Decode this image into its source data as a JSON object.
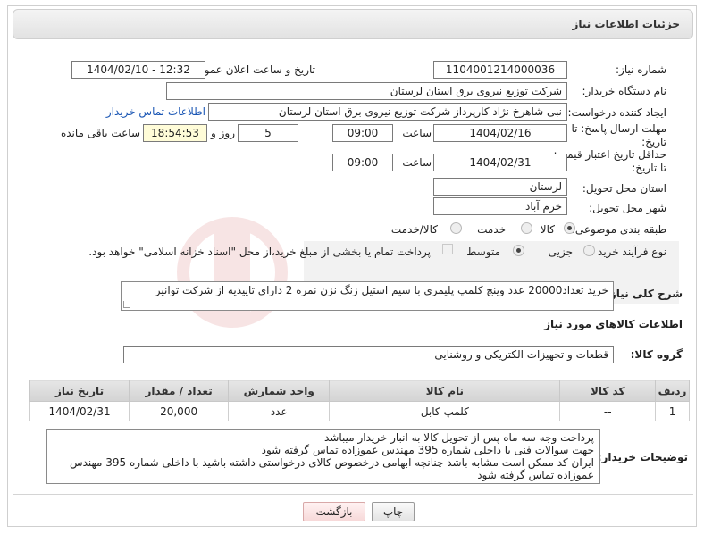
{
  "header": {
    "title": "جزئیات اطلاعات نیاز"
  },
  "form": {
    "need_number": {
      "label": "شماره نیاز:",
      "value": "1104001214000036"
    },
    "announce_datetime": {
      "label": "تاریخ و ساعت اعلان عمومی:",
      "value": "1404/02/10 - 12:32"
    },
    "buyer_org": {
      "label": "نام دستگاه خریدار:",
      "value": "شرکت توزیع نیروی برق استان لرستان"
    },
    "requester": {
      "label": "ایجاد کننده درخواست:",
      "value": "نبی شاهرخ نژاد کارپرداز شرکت توزیع نیروی برق استان لرستان",
      "contact_link": "اطلاعات تماس خریدار"
    },
    "reply_deadline": {
      "label_line1": "مهلت ارسال پاسخ: تا",
      "label_line2": "تاریخ:",
      "date": "1404/02/16",
      "time_label": "ساعت",
      "time": "09:00",
      "days_value": "5",
      "days_label": "روز و",
      "remaining_time": "18:54:53",
      "remaining_label": "ساعت باقی مانده"
    },
    "price_validity": {
      "label_line1": "حداقل تاریخ اعتبار قیمت:",
      "label_line2": "تا تاریخ:",
      "date": "1404/02/31",
      "time_label": "ساعت",
      "time": "09:00"
    },
    "delivery_province": {
      "label": "استان محل تحویل:",
      "value": "لرستان"
    },
    "delivery_city": {
      "label": "شهر محل تحویل:",
      "value": "خرم آباد"
    },
    "category": {
      "label": "طبقه بندی موضوعی:",
      "options": [
        "کالا",
        "خدمت",
        "کالا/خدمت"
      ],
      "selected": "کالا"
    },
    "purchase_type": {
      "label": "نوع فرآیند خرید :",
      "options": [
        "جزیی",
        "متوسط"
      ],
      "selected": "متوسط",
      "treasury_note": "پرداخت تمام یا بخشی از مبلغ خرید،از محل \"اسناد خزانه اسلامی\" خواهد بود."
    },
    "general_description": {
      "label": "شرح کلی نیاز:",
      "value": "خرید تعداد20000 عدد وینچ کلمپ پلیمری با سیم  استیل زنگ نزن  نمره 2 دارای تاییدیه از شرکت توانیر"
    }
  },
  "goods_section": {
    "title": "اطلاعات کالاهای مورد نیاز",
    "group_label": "گروه کالا:",
    "group_value": "قطعات و تجهیزات الکتریکی و روشنایی",
    "table": {
      "columns": [
        "ردیف",
        "کد کالا",
        "نام کالا",
        "واحد شمارش",
        "تعداد / مقدار",
        "تاریخ نیاز"
      ],
      "rows": [
        [
          "1",
          "--",
          "کلمپ کابل",
          "عدد",
          "20,000",
          "1404/02/31"
        ]
      ]
    }
  },
  "buyer_notes": {
    "label": "توضیحات خریدار:",
    "lines": [
      "پرداخت وجه سه ماه پس از تحویل کالا  به انبار خریدار میباشد",
      "جهت سوالات فنی با داخلی شماره 395 مهندس عموزاده تماس گرفته شود",
      "ایران کد ممکن است مشابه باشد چنانچه ابهامی درخصوص کالای درخواستی داشته باشید با داخلی شماره 395 مهندس",
      "عموزاده تماس گرفته شود"
    ]
  },
  "buttons": {
    "print": "چاپ",
    "back": "بازگشت"
  },
  "colors": {
    "header_bg": "#e6e6e6",
    "link": "#1a56b4",
    "yellow_field": "#fffcd8",
    "back_button": "#f7d9d9"
  }
}
